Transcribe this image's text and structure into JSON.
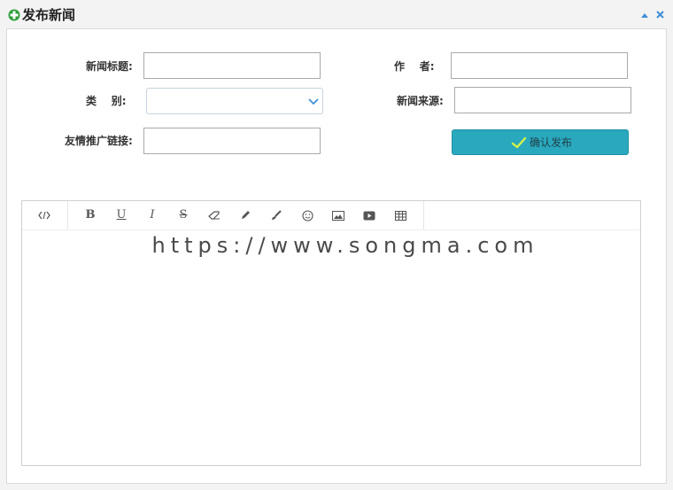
{
  "dialog": {
    "title": "发布新闻",
    "icons": {
      "title": "add-circle-icon",
      "collapse": "collapse-up-icon",
      "close": "close-icon"
    }
  },
  "form": {
    "news_title": {
      "label": "新闻标题:",
      "value": ""
    },
    "author": {
      "label": "作    者:",
      "value": ""
    },
    "category": {
      "label": "类    别:",
      "selected": ""
    },
    "source": {
      "label": "新闻来源:",
      "value": ""
    },
    "promo_link": {
      "label": "友情推广链接:",
      "value": ""
    },
    "submit": {
      "label": "确认发布",
      "icon": "checkmark-icon"
    }
  },
  "editor": {
    "toolbar": [
      {
        "name": "source-code-icon",
        "glyph": "‹/›"
      },
      {
        "name": "bold-icon",
        "glyph": "B"
      },
      {
        "name": "underline-icon",
        "glyph": "U"
      },
      {
        "name": "italic-icon",
        "glyph": "I"
      },
      {
        "name": "strikethrough-icon",
        "glyph": "S"
      },
      {
        "name": "eraser-icon",
        "glyph": ""
      },
      {
        "name": "pencil-icon",
        "glyph": ""
      },
      {
        "name": "brush-icon",
        "glyph": ""
      },
      {
        "name": "smiley-icon",
        "glyph": "☺"
      },
      {
        "name": "image-icon",
        "glyph": ""
      },
      {
        "name": "video-icon",
        "glyph": ""
      },
      {
        "name": "table-icon",
        "glyph": ""
      }
    ],
    "watermark": "https://www.songma.com",
    "content": ""
  },
  "colors": {
    "accent": "#2aa8bd",
    "title_icon": "#2e9e3a",
    "window_icons": "#3f8fd6"
  }
}
